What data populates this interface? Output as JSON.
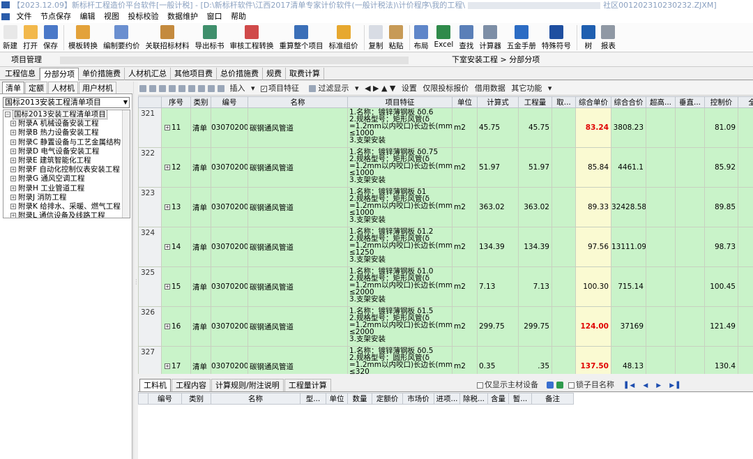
{
  "window": {
    "title_prefix": "【2023.12.09】新标杆工程造价平台软件[一般计税] - [D:\\新标杆软件\\江西2017清单专家计价软件(一般计税法)\\计价程序\\我的工程\\",
    "title_suffix": "社区001202310230232.ZJXM]"
  },
  "menu": [
    "文件",
    "节点保存",
    "编辑",
    "视图",
    "投标校验",
    "数据维护",
    "窗口",
    "帮助"
  ],
  "toolbar": [
    {
      "label": "新建",
      "icon": "new-file-icon",
      "color": "#e8e8e8"
    },
    {
      "label": "打开",
      "icon": "open-folder-icon",
      "color": "#f2b84b"
    },
    {
      "label": "保存",
      "icon": "save-disk-icon",
      "color": "#4a78c8"
    },
    {
      "label": "模板转换",
      "icon": "template-convert-icon",
      "color": "#e3a23a"
    },
    {
      "label": "编制要约价",
      "icon": "edit-price-icon",
      "color": "#6a8fd0"
    },
    {
      "label": "关联招标材料",
      "icon": "link-material-icon",
      "color": "#c48a3e"
    },
    {
      "label": "导出标书",
      "icon": "export-bid-icon",
      "color": "#3f8f6c"
    },
    {
      "label": "审核工程转换",
      "icon": "audit-convert-icon",
      "color": "#d04a4a"
    },
    {
      "label": "重算整个项目",
      "icon": "recalc-icon",
      "color": "#3b6fb8"
    },
    {
      "label": "标准组价",
      "icon": "standard-price-icon",
      "color": "#e7a82f"
    },
    {
      "label": "复制",
      "icon": "copy-icon",
      "color": "#d8dce4"
    },
    {
      "label": "粘贴",
      "icon": "paste-icon",
      "color": "#c79a56"
    },
    {
      "label": "布局",
      "icon": "layout-icon",
      "color": "#5f86c9"
    },
    {
      "label": "Excel",
      "icon": "excel-icon",
      "color": "#2f8a4a"
    },
    {
      "label": "查找",
      "icon": "find-icon",
      "color": "#5a7fb8"
    },
    {
      "label": "计算器",
      "icon": "calculator-icon",
      "color": "#7d8ea6"
    },
    {
      "label": "五金手册",
      "icon": "hardware-manual-icon",
      "color": "#2c6cc4"
    },
    {
      "label": "特殊符号",
      "icon": "omega-symbol-icon",
      "color": "#1f4fa0"
    },
    {
      "label": "树",
      "icon": "tree-icon",
      "color": "#1f5fb0"
    },
    {
      "label": "报表",
      "icon": "report-print-icon",
      "color": "#8f98a4"
    }
  ],
  "project_bar": {
    "label": "项目管理",
    "breadcrumb": "下室安装工程 > 分部分项"
  },
  "main_tabs": [
    "工程信息",
    "分部分项",
    "单价措施费",
    "人材机汇总",
    "其他项目费",
    "总价措施费",
    "规费",
    "取费计算"
  ],
  "main_tabs_active": 1,
  "left_tabs": [
    "清单",
    "定额",
    "人材机",
    "用户材机"
  ],
  "left_tabs_active": 0,
  "library_select": "国标2013安装工程清单项目",
  "tree": {
    "root": "国标2013安装工程清单项目",
    "children": [
      "附录A 机械设备安装工程",
      "附录B 热力设备安装工程",
      "附录C 静置设备与工艺金属结构",
      "附录D 电气设备安装工程",
      "附录E 建筑智能化工程",
      "附录F 自动化控制仪表安装工程",
      "附录G 通风空调工程",
      "附录H 工业管道工程",
      "附录J 消防工程",
      "附录K 给排水、采暖、燃气工程",
      "附录L 通信设备及线路工程"
    ]
  },
  "grid_toolbar": {
    "insert": "插入",
    "item_feature": "项目特征",
    "filter": "过滤显示",
    "settings": "设置",
    "bid_only": "仅限投标报价",
    "borrow": "借用数据",
    "other": "其它功能"
  },
  "columns": [
    "序号",
    "类别",
    "编号",
    "名称",
    "项目特征",
    "单位",
    "计算式",
    "工程量",
    "取...",
    "综合单价",
    "综合合价",
    "超高...",
    "垂直...",
    "控制价",
    "全"
  ],
  "rows": [
    {
      "rownum": "321",
      "seq": "11",
      "type": "清单",
      "code": "030702001011",
      "name": "碳钢通风管道",
      "feature": [
        "1.名称：镀锌薄钢板 δ0.6",
        "2.规格型号：矩形风管(δ",
        "=1.2mm以内咬口)长边长(mm)",
        "≤1000",
        "3.支架安装"
      ],
      "unit": "m2",
      "formula": "45.75",
      "qty": "45.75",
      "unit_price": "83.24",
      "price_red": true,
      "total": "3808.23",
      "control": "81.09"
    },
    {
      "rownum": "322",
      "seq": "12",
      "type": "清单",
      "code": "030702001012",
      "name": "碳钢通风管道",
      "feature": [
        "1.名称：镀锌薄钢板 δ0.75",
        "2.规格型号：矩形风管(δ",
        "=1.2mm以内咬口)长边长(mm)",
        "≤1000",
        "3.支架安装"
      ],
      "unit": "m2",
      "formula": "51.97",
      "qty": "51.97",
      "unit_price": "85.84",
      "price_red": false,
      "total": "4461.1",
      "control": "85.92"
    },
    {
      "rownum": "323",
      "seq": "13",
      "type": "清单",
      "code": "030702001013",
      "name": "碳钢通风管道",
      "feature": [
        "1.名称：镀锌薄钢板 δ1",
        "2.规格型号：矩形风管(δ",
        "=1.2mm以内咬口)长边长(mm)",
        "≤1000",
        "3.支架安装"
      ],
      "unit": "m2",
      "formula": "363.02",
      "qty": "363.02",
      "unit_price": "89.33",
      "price_red": false,
      "total": "32428.58",
      "control": "89.85"
    },
    {
      "rownum": "324",
      "seq": "14",
      "type": "清单",
      "code": "030702001014",
      "name": "碳钢通风管道",
      "feature": [
        "1.名称：镀锌薄钢板 δ1.2",
        "2.规格型号：矩形风管(δ",
        "=1.2mm以内咬口)长边长(mm)",
        "≤1250",
        "3.支架安装"
      ],
      "unit": "m2",
      "formula": "134.39",
      "qty": "134.39",
      "unit_price": "97.56",
      "price_red": false,
      "total": "13111.09",
      "control": "98.73"
    },
    {
      "rownum": "325",
      "seq": "15",
      "type": "清单",
      "code": "030702001015",
      "name": "碳钢通风管道",
      "feature": [
        "1.名称：镀锌薄钢板 δ1.0",
        "2.规格型号：矩形风管(δ",
        "=1.2mm以内咬口)长边长(mm)",
        "≤2000",
        "3.支架安装"
      ],
      "unit": "m2",
      "formula": "7.13",
      "qty": "7.13",
      "unit_price": "100.30",
      "price_red": false,
      "total": "715.14",
      "control": "100.45"
    },
    {
      "rownum": "326",
      "seq": "16",
      "type": "清单",
      "code": "030702001016",
      "name": "碳钢通风管道",
      "feature": [
        "1.名称：镀锌薄钢板 δ1.5",
        "2.规格型号：矩形风管(δ",
        "=1.2mm以内咬口)长边长(mm)",
        "≤2000",
        "3.支架安装"
      ],
      "unit": "m2",
      "formula": "299.75",
      "qty": "299.75",
      "unit_price": "124.00",
      "price_red": true,
      "total": "37169",
      "control": "121.49"
    },
    {
      "rownum": "327",
      "seq": "17",
      "type": "清单",
      "code": "030702001017",
      "name": "碳钢通风管道",
      "feature": [
        "1.名称：镀锌薄钢板 δ0.5",
        "2.规格型号：圆形风管(δ",
        "=1.2mm以内咬口)长边长(mm)",
        "≤320"
      ],
      "unit": "m2",
      "formula": "0.35",
      "qty": ".35",
      "unit_price": "137.50",
      "price_red": true,
      "total": "48.13",
      "control": "130.4"
    }
  ],
  "bottom_tabs": [
    "工料机",
    "工程内容",
    "计算规则/附注说明",
    "工程量计算"
  ],
  "bottom_tabs_active": 0,
  "bottom_options": {
    "main_only": "仅显示主材设备",
    "lock_name": "锁子目名称"
  },
  "sub_columns": [
    "编号",
    "类别",
    "名称",
    "型...",
    "单位",
    "数量",
    "定额价",
    "市场价",
    "进项...",
    "除税...",
    "含量",
    "暂...",
    "备注"
  ],
  "colors": {
    "green": "#c9f3c9",
    "yellow": "#fafad2",
    "red": "#e00000"
  }
}
